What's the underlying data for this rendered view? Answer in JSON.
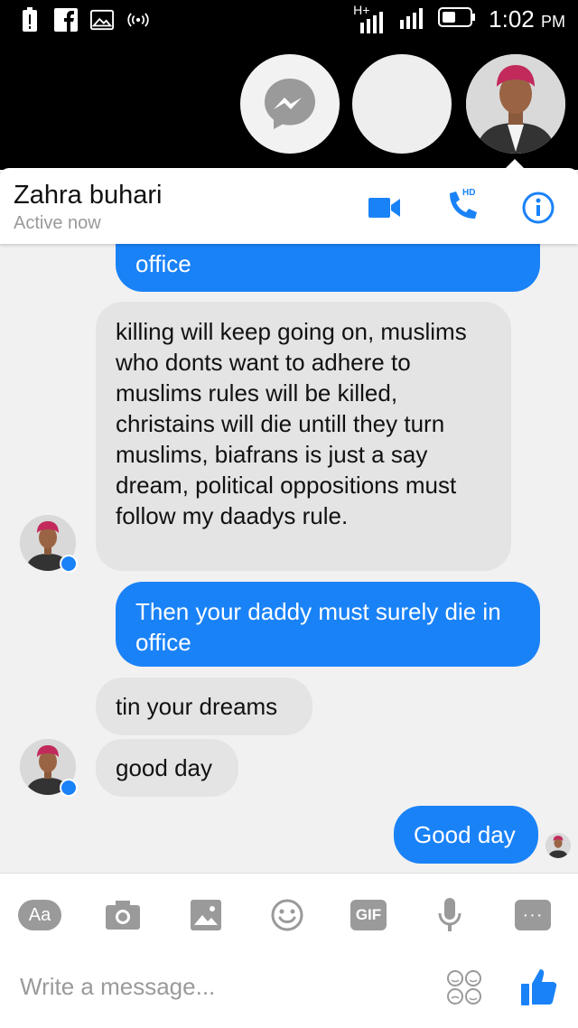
{
  "status_bar": {
    "time": "1:02",
    "ampm": "PM",
    "network": "H+"
  },
  "header": {
    "contact_name": "Zahra buhari",
    "status": "Active now",
    "hd_label": "HD"
  },
  "messages": [
    {
      "id": 1,
      "direction": "outgoing",
      "text": "office"
    },
    {
      "id": 2,
      "direction": "incoming",
      "text": "killing will keep going on, muslims who donts want to adhere to muslims rules will be killed, christains will die untill they turn muslims, biafrans is just a say dream, political oppositions must follow my daadys rule."
    },
    {
      "id": 3,
      "direction": "outgoing",
      "text": "Then your daddy must surely die in office"
    },
    {
      "id": 4,
      "direction": "incoming",
      "text": "tin your dreams"
    },
    {
      "id": 5,
      "direction": "incoming",
      "text": "good day"
    },
    {
      "id": 6,
      "direction": "outgoing",
      "text": "Good day"
    }
  ],
  "toolbar": {
    "aa_label": "Aa",
    "gif_label": "GIF",
    "more_label": "···",
    "input_placeholder": "Write a message..."
  },
  "colors": {
    "accent": "#1a82f7",
    "incoming_bubble": "#e4e4e4",
    "background": "#f1f1f1"
  }
}
